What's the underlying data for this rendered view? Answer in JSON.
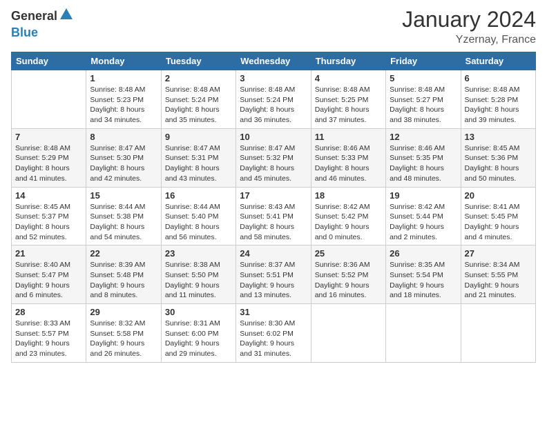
{
  "logo": {
    "general": "General",
    "blue": "Blue"
  },
  "title": "January 2024",
  "location": "Yzernay, France",
  "days_of_week": [
    "Sunday",
    "Monday",
    "Tuesday",
    "Wednesday",
    "Thursday",
    "Friday",
    "Saturday"
  ],
  "weeks": [
    [
      {
        "day": "",
        "info": ""
      },
      {
        "day": "1",
        "info": "Sunrise: 8:48 AM\nSunset: 5:23 PM\nDaylight: 8 hours\nand 34 minutes."
      },
      {
        "day": "2",
        "info": "Sunrise: 8:48 AM\nSunset: 5:24 PM\nDaylight: 8 hours\nand 35 minutes."
      },
      {
        "day": "3",
        "info": "Sunrise: 8:48 AM\nSunset: 5:24 PM\nDaylight: 8 hours\nand 36 minutes."
      },
      {
        "day": "4",
        "info": "Sunrise: 8:48 AM\nSunset: 5:25 PM\nDaylight: 8 hours\nand 37 minutes."
      },
      {
        "day": "5",
        "info": "Sunrise: 8:48 AM\nSunset: 5:27 PM\nDaylight: 8 hours\nand 38 minutes."
      },
      {
        "day": "6",
        "info": "Sunrise: 8:48 AM\nSunset: 5:28 PM\nDaylight: 8 hours\nand 39 minutes."
      }
    ],
    [
      {
        "day": "7",
        "info": "Sunrise: 8:48 AM\nSunset: 5:29 PM\nDaylight: 8 hours\nand 41 minutes."
      },
      {
        "day": "8",
        "info": "Sunrise: 8:47 AM\nSunset: 5:30 PM\nDaylight: 8 hours\nand 42 minutes."
      },
      {
        "day": "9",
        "info": "Sunrise: 8:47 AM\nSunset: 5:31 PM\nDaylight: 8 hours\nand 43 minutes."
      },
      {
        "day": "10",
        "info": "Sunrise: 8:47 AM\nSunset: 5:32 PM\nDaylight: 8 hours\nand 45 minutes."
      },
      {
        "day": "11",
        "info": "Sunrise: 8:46 AM\nSunset: 5:33 PM\nDaylight: 8 hours\nand 46 minutes."
      },
      {
        "day": "12",
        "info": "Sunrise: 8:46 AM\nSunset: 5:35 PM\nDaylight: 8 hours\nand 48 minutes."
      },
      {
        "day": "13",
        "info": "Sunrise: 8:45 AM\nSunset: 5:36 PM\nDaylight: 8 hours\nand 50 minutes."
      }
    ],
    [
      {
        "day": "14",
        "info": "Sunrise: 8:45 AM\nSunset: 5:37 PM\nDaylight: 8 hours\nand 52 minutes."
      },
      {
        "day": "15",
        "info": "Sunrise: 8:44 AM\nSunset: 5:38 PM\nDaylight: 8 hours\nand 54 minutes."
      },
      {
        "day": "16",
        "info": "Sunrise: 8:44 AM\nSunset: 5:40 PM\nDaylight: 8 hours\nand 56 minutes."
      },
      {
        "day": "17",
        "info": "Sunrise: 8:43 AM\nSunset: 5:41 PM\nDaylight: 8 hours\nand 58 minutes."
      },
      {
        "day": "18",
        "info": "Sunrise: 8:42 AM\nSunset: 5:42 PM\nDaylight: 9 hours\nand 0 minutes."
      },
      {
        "day": "19",
        "info": "Sunrise: 8:42 AM\nSunset: 5:44 PM\nDaylight: 9 hours\nand 2 minutes."
      },
      {
        "day": "20",
        "info": "Sunrise: 8:41 AM\nSunset: 5:45 PM\nDaylight: 9 hours\nand 4 minutes."
      }
    ],
    [
      {
        "day": "21",
        "info": "Sunrise: 8:40 AM\nSunset: 5:47 PM\nDaylight: 9 hours\nand 6 minutes."
      },
      {
        "day": "22",
        "info": "Sunrise: 8:39 AM\nSunset: 5:48 PM\nDaylight: 9 hours\nand 8 minutes."
      },
      {
        "day": "23",
        "info": "Sunrise: 8:38 AM\nSunset: 5:50 PM\nDaylight: 9 hours\nand 11 minutes."
      },
      {
        "day": "24",
        "info": "Sunrise: 8:37 AM\nSunset: 5:51 PM\nDaylight: 9 hours\nand 13 minutes."
      },
      {
        "day": "25",
        "info": "Sunrise: 8:36 AM\nSunset: 5:52 PM\nDaylight: 9 hours\nand 16 minutes."
      },
      {
        "day": "26",
        "info": "Sunrise: 8:35 AM\nSunset: 5:54 PM\nDaylight: 9 hours\nand 18 minutes."
      },
      {
        "day": "27",
        "info": "Sunrise: 8:34 AM\nSunset: 5:55 PM\nDaylight: 9 hours\nand 21 minutes."
      }
    ],
    [
      {
        "day": "28",
        "info": "Sunrise: 8:33 AM\nSunset: 5:57 PM\nDaylight: 9 hours\nand 23 minutes."
      },
      {
        "day": "29",
        "info": "Sunrise: 8:32 AM\nSunset: 5:58 PM\nDaylight: 9 hours\nand 26 minutes."
      },
      {
        "day": "30",
        "info": "Sunrise: 8:31 AM\nSunset: 6:00 PM\nDaylight: 9 hours\nand 29 minutes."
      },
      {
        "day": "31",
        "info": "Sunrise: 8:30 AM\nSunset: 6:02 PM\nDaylight: 9 hours\nand 31 minutes."
      },
      {
        "day": "",
        "info": ""
      },
      {
        "day": "",
        "info": ""
      },
      {
        "day": "",
        "info": ""
      }
    ]
  ]
}
